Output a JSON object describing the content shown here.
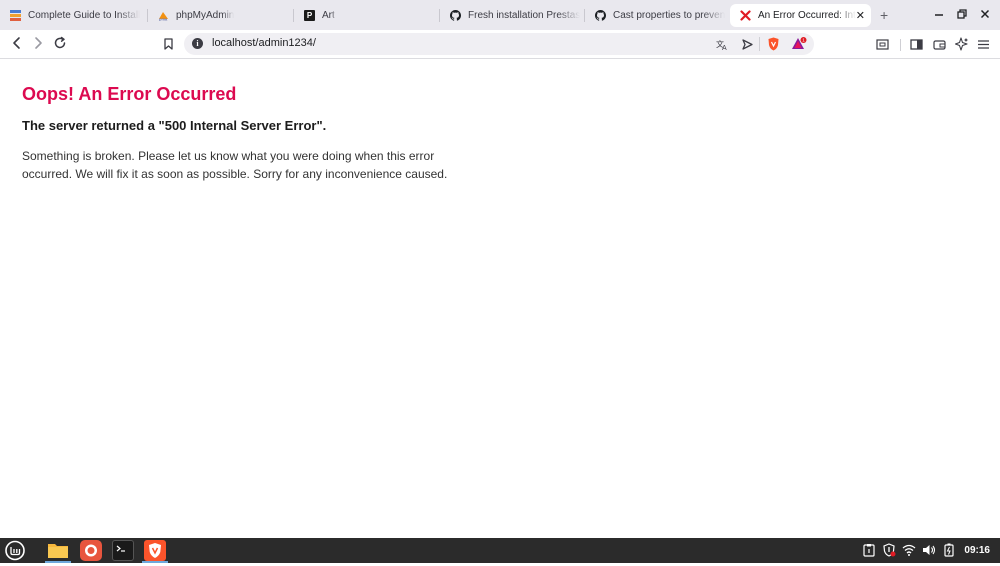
{
  "browser": {
    "tabs": [
      {
        "label": "Complete Guide to Install",
        "icon": "stack-icon"
      },
      {
        "label": "phpMyAdmin",
        "icon": "phpmyadmin-icon"
      },
      {
        "label": "Art",
        "icon": "p-icon"
      },
      {
        "label": "Fresh installation Prestas",
        "icon": "github-icon"
      },
      {
        "label": "Cast properties to preven",
        "icon": "github-icon"
      },
      {
        "label": "An Error Occurred: Int",
        "icon": "red-x-icon",
        "active": true
      }
    ],
    "url": "localhost/admin1234/",
    "shields_badge": "1"
  },
  "page": {
    "title": "Oops! An Error Occurred",
    "subtitle": "The server returned a \"500 Internal Server Error\".",
    "body": "Something is broken. Please let us know what you were doing when this error occurred. We will fix it as soon as possible. Sorry for any inconvenience caused."
  },
  "taskbar": {
    "clock": "09:16"
  },
  "colors": {
    "error_title": "#dc0a50",
    "tabstrip_bg": "#e9e8ee",
    "taskbar_bg": "#2b2b2b"
  }
}
